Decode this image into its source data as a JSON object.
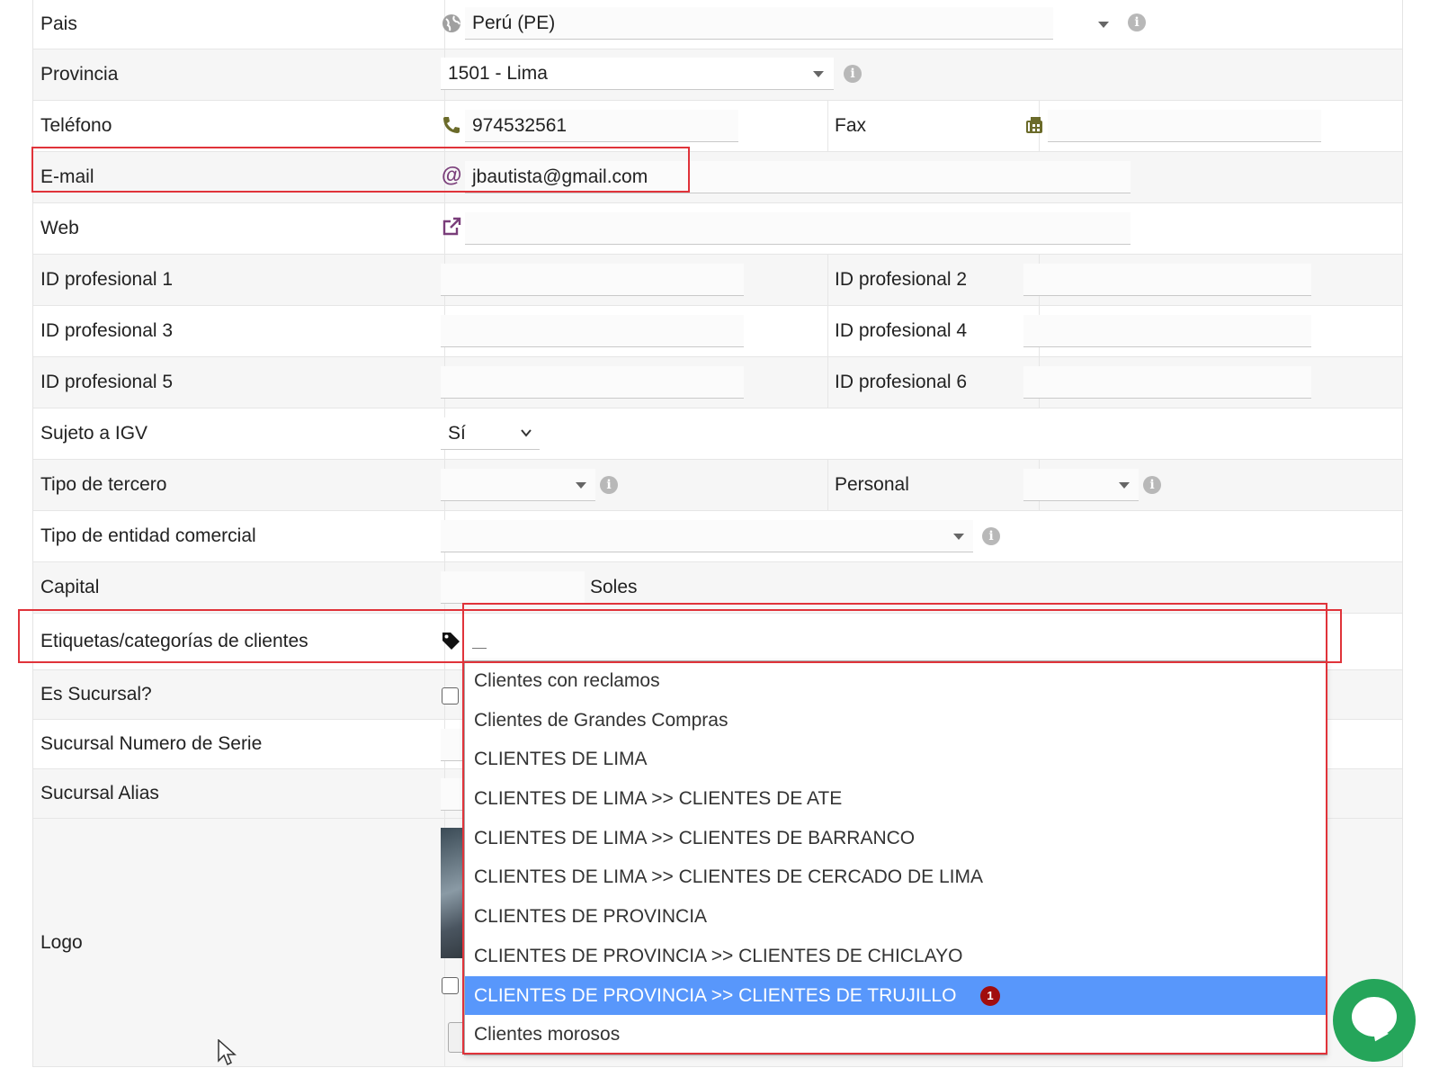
{
  "form": {
    "pais_label": "Pais",
    "pais_value": "Perú (PE)",
    "provincia_label": "Provincia",
    "provincia_value": "1501 - Lima",
    "telefono_label": "Teléfono",
    "telefono_value": "974532561",
    "fax_label": "Fax",
    "fax_value": "",
    "email_label": "E-mail",
    "email_value": "jbautista@gmail.com",
    "web_label": "Web",
    "web_value": "",
    "idprof1_label": "ID profesional 1",
    "idprof2_label": "ID profesional 2",
    "idprof3_label": "ID profesional 3",
    "idprof4_label": "ID profesional 4",
    "idprof5_label": "ID profesional 5",
    "idprof6_label": "ID profesional 6",
    "igv_label": "Sujeto a IGV",
    "igv_value": "Sí",
    "tipo_tercero_label": "Tipo de tercero",
    "personal_label": "Personal",
    "tipo_entidad_label": "Tipo de entidad comercial",
    "capital_label": "Capital",
    "capital_currency": "Soles",
    "etiquetas_label": "Etiquetas/categorías de clientes",
    "sucursal_label": "Es Sucursal?",
    "sucursal_serie_label": "Sucursal Numero de Serie",
    "sucursal_alias_label": "Sucursal Alias",
    "logo_label": "Logo"
  },
  "dropdown": {
    "options": [
      "Clientes con reclamos",
      "Clientes de Grandes Compras",
      "CLIENTES DE LIMA",
      "CLIENTES DE LIMA >> CLIENTES DE ATE",
      "CLIENTES DE LIMA >> CLIENTES DE BARRANCO",
      "CLIENTES DE LIMA >> CLIENTES DE CERCADO DE LIMA",
      "CLIENTES DE PROVINCIA",
      "CLIENTES DE PROVINCIA >> CLIENTES DE CHICLAYO",
      "CLIENTES DE PROVINCIA >> CLIENTES DE TRUJILLO",
      "Clientes morosos"
    ],
    "selected_badge": "1"
  },
  "colors": {
    "highlight": "#5897fb",
    "annotation_red": "#e0333a",
    "chat_green": "#25a55a",
    "icon_purple": "#7a3e7a",
    "icon_olive": "#6b6b2a"
  }
}
